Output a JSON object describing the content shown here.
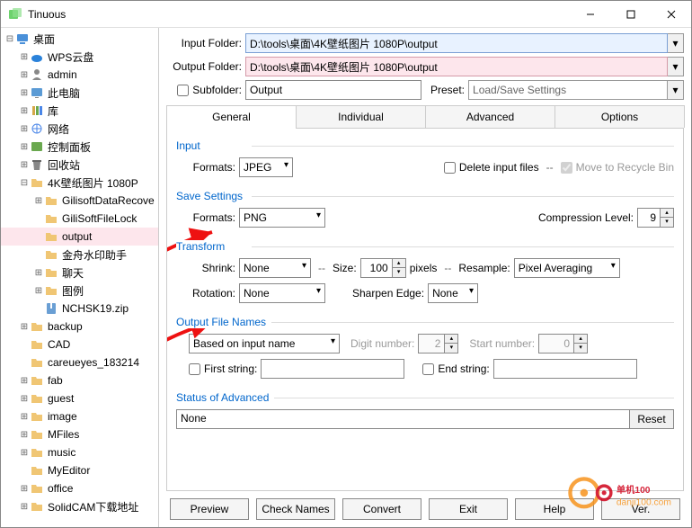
{
  "title": "Tinuous",
  "tree": [
    {
      "level": 0,
      "toggle": "-",
      "icon": "desktop",
      "label": "桌面",
      "sel": false
    },
    {
      "level": 1,
      "toggle": "+",
      "icon": "cloud",
      "label": "WPS云盘",
      "sel": false
    },
    {
      "level": 1,
      "toggle": "+",
      "icon": "user",
      "label": "admin",
      "sel": false
    },
    {
      "level": 1,
      "toggle": "+",
      "icon": "pc",
      "label": "此电脑",
      "sel": false
    },
    {
      "level": 1,
      "toggle": "+",
      "icon": "lib",
      "label": "库",
      "sel": false
    },
    {
      "level": 1,
      "toggle": "+",
      "icon": "net",
      "label": "网络",
      "sel": false
    },
    {
      "level": 1,
      "toggle": "+",
      "icon": "panel",
      "label": "控制面板",
      "sel": false
    },
    {
      "level": 1,
      "toggle": "+",
      "icon": "bin",
      "label": "回收站",
      "sel": false
    },
    {
      "level": 1,
      "toggle": "-",
      "icon": "folder",
      "label": "4K壁纸图片 1080P",
      "sel": false
    },
    {
      "level": 2,
      "toggle": "+",
      "icon": "folder",
      "label": "GilisoftDataRecove",
      "sel": false
    },
    {
      "level": 2,
      "toggle": "",
      "icon": "folder",
      "label": "GiliSoftFileLock",
      "sel": false
    },
    {
      "level": 2,
      "toggle": "",
      "icon": "folder",
      "label": "output",
      "sel": true
    },
    {
      "level": 2,
      "toggle": "",
      "icon": "folder",
      "label": "金舟水印助手",
      "sel": false
    },
    {
      "level": 2,
      "toggle": "+",
      "icon": "folder",
      "label": "聊天",
      "sel": false
    },
    {
      "level": 2,
      "toggle": "+",
      "icon": "folder",
      "label": "图例",
      "sel": false
    },
    {
      "level": 2,
      "toggle": "",
      "icon": "zip",
      "label": "NCHSK19.zip",
      "sel": false
    },
    {
      "level": 1,
      "toggle": "+",
      "icon": "folder",
      "label": "backup",
      "sel": false
    },
    {
      "level": 1,
      "toggle": "",
      "icon": "folder",
      "label": "CAD",
      "sel": false
    },
    {
      "level": 1,
      "toggle": "",
      "icon": "folder",
      "label": "careueyes_183214",
      "sel": false
    },
    {
      "level": 1,
      "toggle": "+",
      "icon": "folder",
      "label": "fab",
      "sel": false
    },
    {
      "level": 1,
      "toggle": "+",
      "icon": "folder",
      "label": "guest",
      "sel": false
    },
    {
      "level": 1,
      "toggle": "+",
      "icon": "folder",
      "label": "image",
      "sel": false
    },
    {
      "level": 1,
      "toggle": "+",
      "icon": "folder",
      "label": "MFiles",
      "sel": false
    },
    {
      "level": 1,
      "toggle": "+",
      "icon": "folder",
      "label": "music",
      "sel": false
    },
    {
      "level": 1,
      "toggle": "",
      "icon": "folder",
      "label": "MyEditor",
      "sel": false
    },
    {
      "level": 1,
      "toggle": "+",
      "icon": "folder",
      "label": "office",
      "sel": false
    },
    {
      "level": 1,
      "toggle": "+",
      "icon": "folder",
      "label": "SolidCAM下载地址",
      "sel": false
    }
  ],
  "folders": {
    "input_label": "Input Folder:",
    "input_value": "D:\\tools\\桌面\\4K壁纸图片 1080P\\output",
    "output_label": "Output Folder:",
    "output_value": "D:\\tools\\桌面\\4K壁纸图片 1080P\\output",
    "subfolder_label": "Subfolder:",
    "subfolder_value": "Output",
    "preset_label": "Preset:",
    "preset_value": "Load/Save Settings"
  },
  "tabs": {
    "general": "General",
    "individual": "Individual",
    "advanced": "Advanced",
    "options": "Options"
  },
  "input_group": {
    "title": "Input",
    "formats_label": "Formats:",
    "formats_value": "JPEG",
    "delete_label": "Delete input files",
    "recycle_label": "Move to Recycle Bin"
  },
  "save_group": {
    "title": "Save Settings",
    "formats_label": "Formats:",
    "formats_value": "PNG",
    "comp_label": "Compression Level:",
    "comp_value": "9"
  },
  "transform_group": {
    "title": "Transform",
    "shrink_label": "Shrink:",
    "shrink_value": "None",
    "size_label": "Size:",
    "size_value": "100",
    "pixels": "pixels",
    "resample_label": "Resample:",
    "resample_value": "Pixel Averaging",
    "rotation_label": "Rotation:",
    "rotation_value": "None",
    "sharpen_label": "Sharpen Edge:",
    "sharpen_value": "None"
  },
  "output_group": {
    "title": "Output File Names",
    "based_value": "Based on input name",
    "digit_label": "Digit number:",
    "digit_value": "2",
    "start_label": "Start number:",
    "start_value": "0",
    "first_label": "First string:",
    "end_label": "End string:"
  },
  "status_group": {
    "title": "Status of Advanced",
    "value": "None",
    "reset": "Reset"
  },
  "footer": {
    "preview": "Preview",
    "check": "Check Names",
    "convert": "Convert",
    "exit": "Exit",
    "help": "Help",
    "ver": "Ver."
  },
  "watermark": {
    "brand": "单机100",
    "url": "danji100.com"
  }
}
